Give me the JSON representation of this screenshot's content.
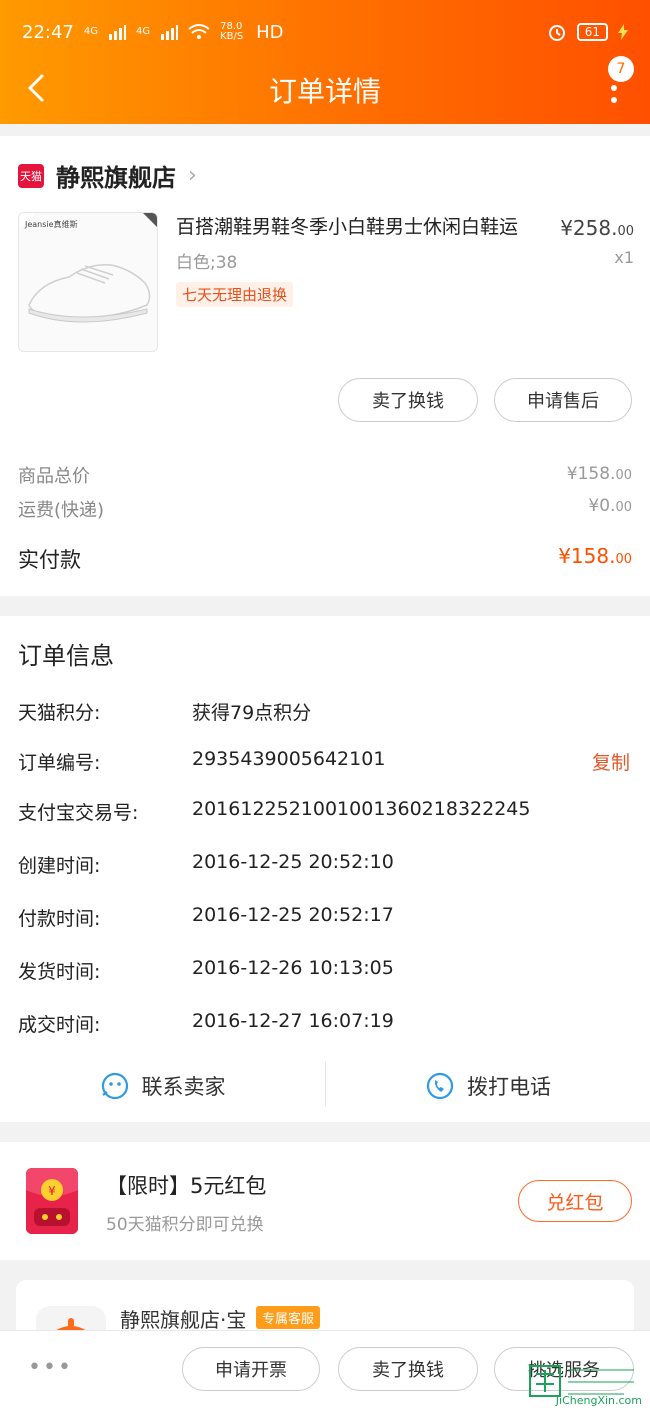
{
  "status_bar": {
    "time": "22:47",
    "net1": "4G",
    "net2": "4G",
    "speed": "78.0\nKB/S",
    "hd": "HD",
    "battery": "61"
  },
  "header": {
    "title": "订单详情",
    "badge_count": "7"
  },
  "store": {
    "logo_text": "天猫",
    "name": "静熙旗舰店"
  },
  "product": {
    "brand_text": "Jeansie真维斯",
    "title": "百搭潮鞋男鞋冬季小白鞋男士休闲白鞋运",
    "sku": "白色;38",
    "return_tag": "七天无理由退换",
    "price_main": "¥258.",
    "price_dec": "00",
    "qty": "x1",
    "sell_button": "卖了换钱",
    "aftersale_button": "申请售后"
  },
  "summary": {
    "total_label": "商品总价",
    "total_main": "¥158.",
    "total_dec": "00",
    "shipping_label": "运费(快递)",
    "shipping_main": "¥0.",
    "shipping_dec": "00",
    "paid_label": "实付款",
    "paid_main": "¥158.",
    "paid_dec": "00"
  },
  "order_info": {
    "title": "订单信息",
    "rows": [
      {
        "label": "天猫积分:",
        "value": "获得79点积分"
      },
      {
        "label": "订单编号:",
        "value": "2935439005642101"
      },
      {
        "label": "支付宝交易号:",
        "value": "2016122521001001360218322245"
      },
      {
        "label": "创建时间:",
        "value": "2016-12-25 20:52:10"
      },
      {
        "label": "付款时间:",
        "value": "2016-12-25 20:52:17"
      },
      {
        "label": "发货时间:",
        "value": "2016-12-26 10:13:05"
      },
      {
        "label": "成交时间:",
        "value": "2016-12-27 16:07:19"
      }
    ],
    "copy_label": "复制",
    "contact_seller": "联系卖家",
    "call_phone": "拨打电话"
  },
  "red_packet": {
    "title": "【限时】5元红包",
    "subtitle": "50天猫积分即可兑换",
    "button": "兑红包"
  },
  "service": {
    "name": "静熙旗舰店·宝",
    "tag": "专属客服"
  },
  "bottom_bar": {
    "invoice": "申请开票",
    "sell": "卖了换钱",
    "more_service": "挑选服务"
  },
  "watermark": {
    "text": "JiChengXin.com"
  },
  "colors": {
    "header_start": "#ff9a00",
    "header_end": "#ff5000",
    "accent": "#ff5000",
    "copy": "#e0592a"
  }
}
